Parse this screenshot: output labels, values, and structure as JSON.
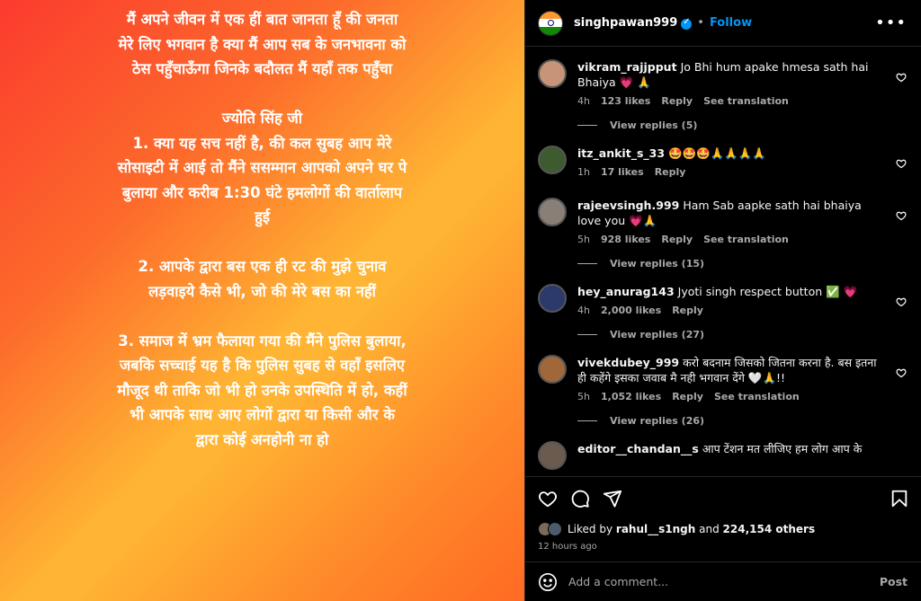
{
  "post": {
    "text": "मैं अपने जीवन में एक हीं बात जानता हूँ की जनता मेरे लिए भगवान है क्या मैं आप सब के जनभावना को ठेस पहुँचाऊँगा जिनके बदौलत मैं यहाँ तक पहुँचा\n\nज्योति सिंह जी\n1. क्या यह सच नहीं है, की कल सुबह आप मेरे सोसाइटी में आई तो मैंने ससम्मान आपको अपने घर पे बुलाया और करीब 1:30 घंटे हमलोगों की वार्तालाप हुई\n\n2. आपके द्वारा बस एक ही रट की मुझे चुनाव लड़वाइये कैसे भी, जो की मेरे बस का नहीं\n\n3. समाज में भ्रम फैलाया गया की मैंने पुलिस बुलाया, जबकि सच्चाई यह है कि पुलिस सुबह से वहाँ इसलिए मौजूद थी ताकि जो भी हो उनके उपस्थिति में हो, कहीं भी आपके साथ आए लोगों द्वारा या किसी और के द्वारा कोई अनहोनी ना हो"
  },
  "header": {
    "username": "singhpawan999",
    "dot": "•",
    "follow_label": "Follow",
    "more": "•••"
  },
  "comments": [
    {
      "user": "vikram_rajjpput",
      "text": "Jo Bhi hum apake hmesa sath hai Bhaiya 💗 🙏",
      "time": "4h",
      "likes": "123 likes",
      "reply": "Reply",
      "translation": "See translation",
      "view_replies": "View replies (5)",
      "avatar_color": "#c89478"
    },
    {
      "user": "itz_ankit_s_33",
      "text": "🤩🤩🤩🙏🙏🙏🙏",
      "time": "1h",
      "likes": "17 likes",
      "reply": "Reply",
      "avatar_color": "#3e5a2f"
    },
    {
      "user": "rajeevsingh.999",
      "text": "Ham Sab aapke sath hai bhaiya love you 💗🙏",
      "time": "5h",
      "likes": "928 likes",
      "reply": "Reply",
      "translation": "See translation",
      "view_replies": "View replies (15)",
      "avatar_color": "#8a7f77"
    },
    {
      "user": "hey_anurag143",
      "text": "Jyoti singh respect button ✅ 💗",
      "time": "4h",
      "likes": "2,000 likes",
      "reply": "Reply",
      "view_replies": "View replies (27)",
      "avatar_color": "#2b3a6b"
    },
    {
      "user": "vivekdubey_999",
      "text": "करो बदनाम जिसको जितना करना है. बस इतना ही कहेंगे इसका जवाब मै नही भगवान देंगे 🤍🙏!!",
      "time": "5h",
      "likes": "1,052 likes",
      "reply": "Reply",
      "translation": "See translation",
      "view_replies": "View replies (26)",
      "avatar_color": "#a0673a"
    },
    {
      "user": "editor__chandan__s",
      "text": "आप टेंशन मत लीजिए हम लोग आप के",
      "avatar_color": "#6b5a4e"
    }
  ],
  "likes": {
    "prefix": "Liked by",
    "user": "rahul__s1ngh",
    "middle": "and",
    "count": "224,154 others",
    "time": "12 hours ago"
  },
  "add_comment": {
    "placeholder": "Add a comment...",
    "post_label": "Post"
  },
  "colors": {
    "accent": "#0095f6",
    "background": "#000000",
    "muted": "#a8a8a8"
  }
}
